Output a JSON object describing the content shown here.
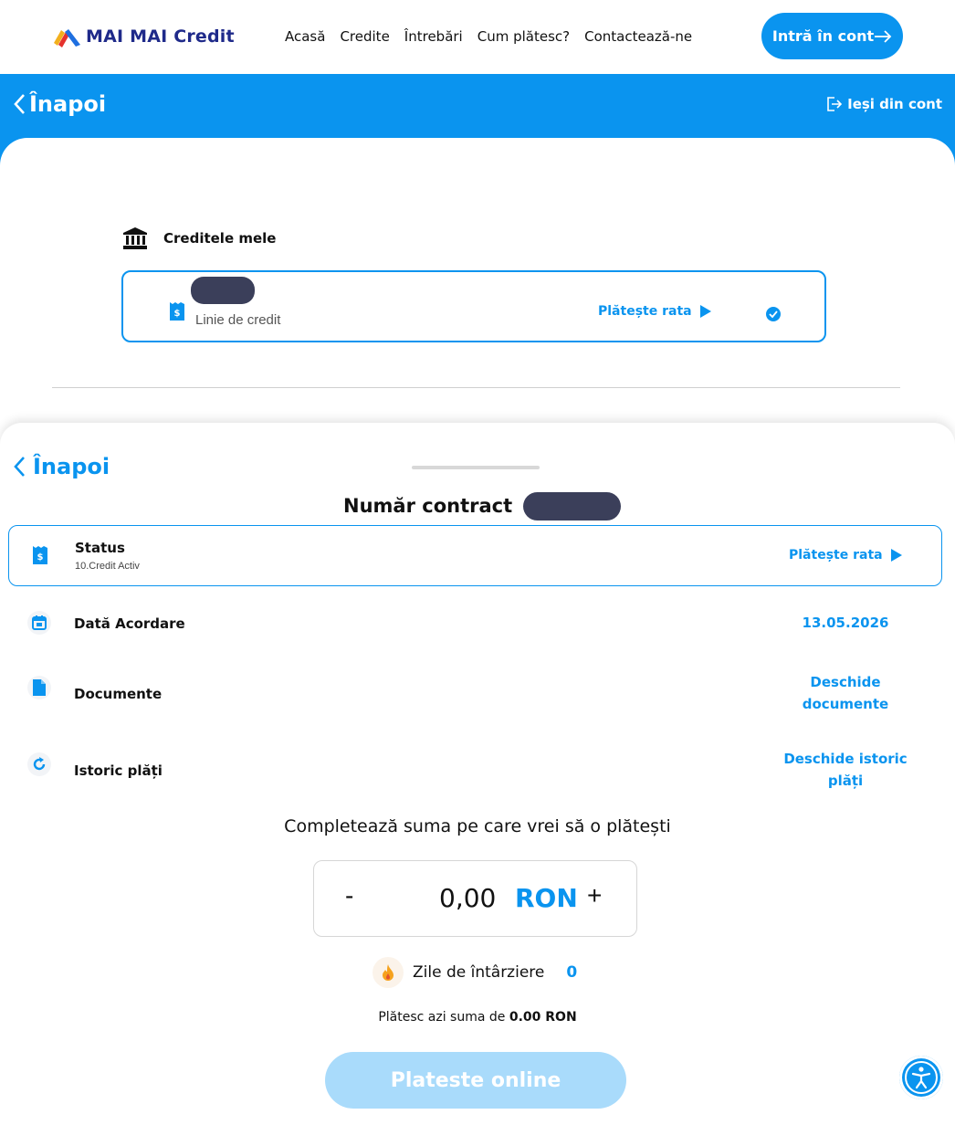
{
  "header": {
    "logo_text": "MAI MAI Credit",
    "nav": [
      "Acasă",
      "Credite",
      "Întrebări",
      "Cum plătesc?",
      "Contactează-ne"
    ],
    "login_label": "Intră în cont"
  },
  "topbar": {
    "back_label": "Înapoi",
    "logout_label": "Ieși din cont"
  },
  "credits": {
    "section_title": "Creditele mele",
    "card": {
      "subtitle": "Linie de credit",
      "pay_label": "Plătește rata"
    }
  },
  "sheet": {
    "back_label": "Înapoi",
    "contract_title": "Număr contract",
    "status": {
      "label": "Status",
      "value": "10.Credit Activ",
      "pay_label": "Plătește rata"
    },
    "rows": [
      {
        "label": "Dată Acordare",
        "value": "13.05.2026",
        "icon": "calendar-icon"
      },
      {
        "label": "Documente",
        "value": "Deschide documente",
        "icon": "document-icon"
      },
      {
        "label": "Istoric plăți",
        "value": "Deschide istoric plăți",
        "icon": "refresh-icon"
      }
    ],
    "amount_title": "Completează suma pe care vrei să o plătești",
    "amount": {
      "minus": "-",
      "value": "0,00",
      "currency": "RON",
      "plus": "+"
    },
    "delay": {
      "label": "Zile de întârziere",
      "value": "0"
    },
    "summary_prefix": "Plătesc azi suma de",
    "summary_amount": "0.00 RON",
    "pay_online_label": "Plateste online"
  },
  "colors": {
    "primary": "#0a94ef",
    "brand_dark": "#1f2a8a",
    "disabled_button": "#a9dbfb"
  }
}
